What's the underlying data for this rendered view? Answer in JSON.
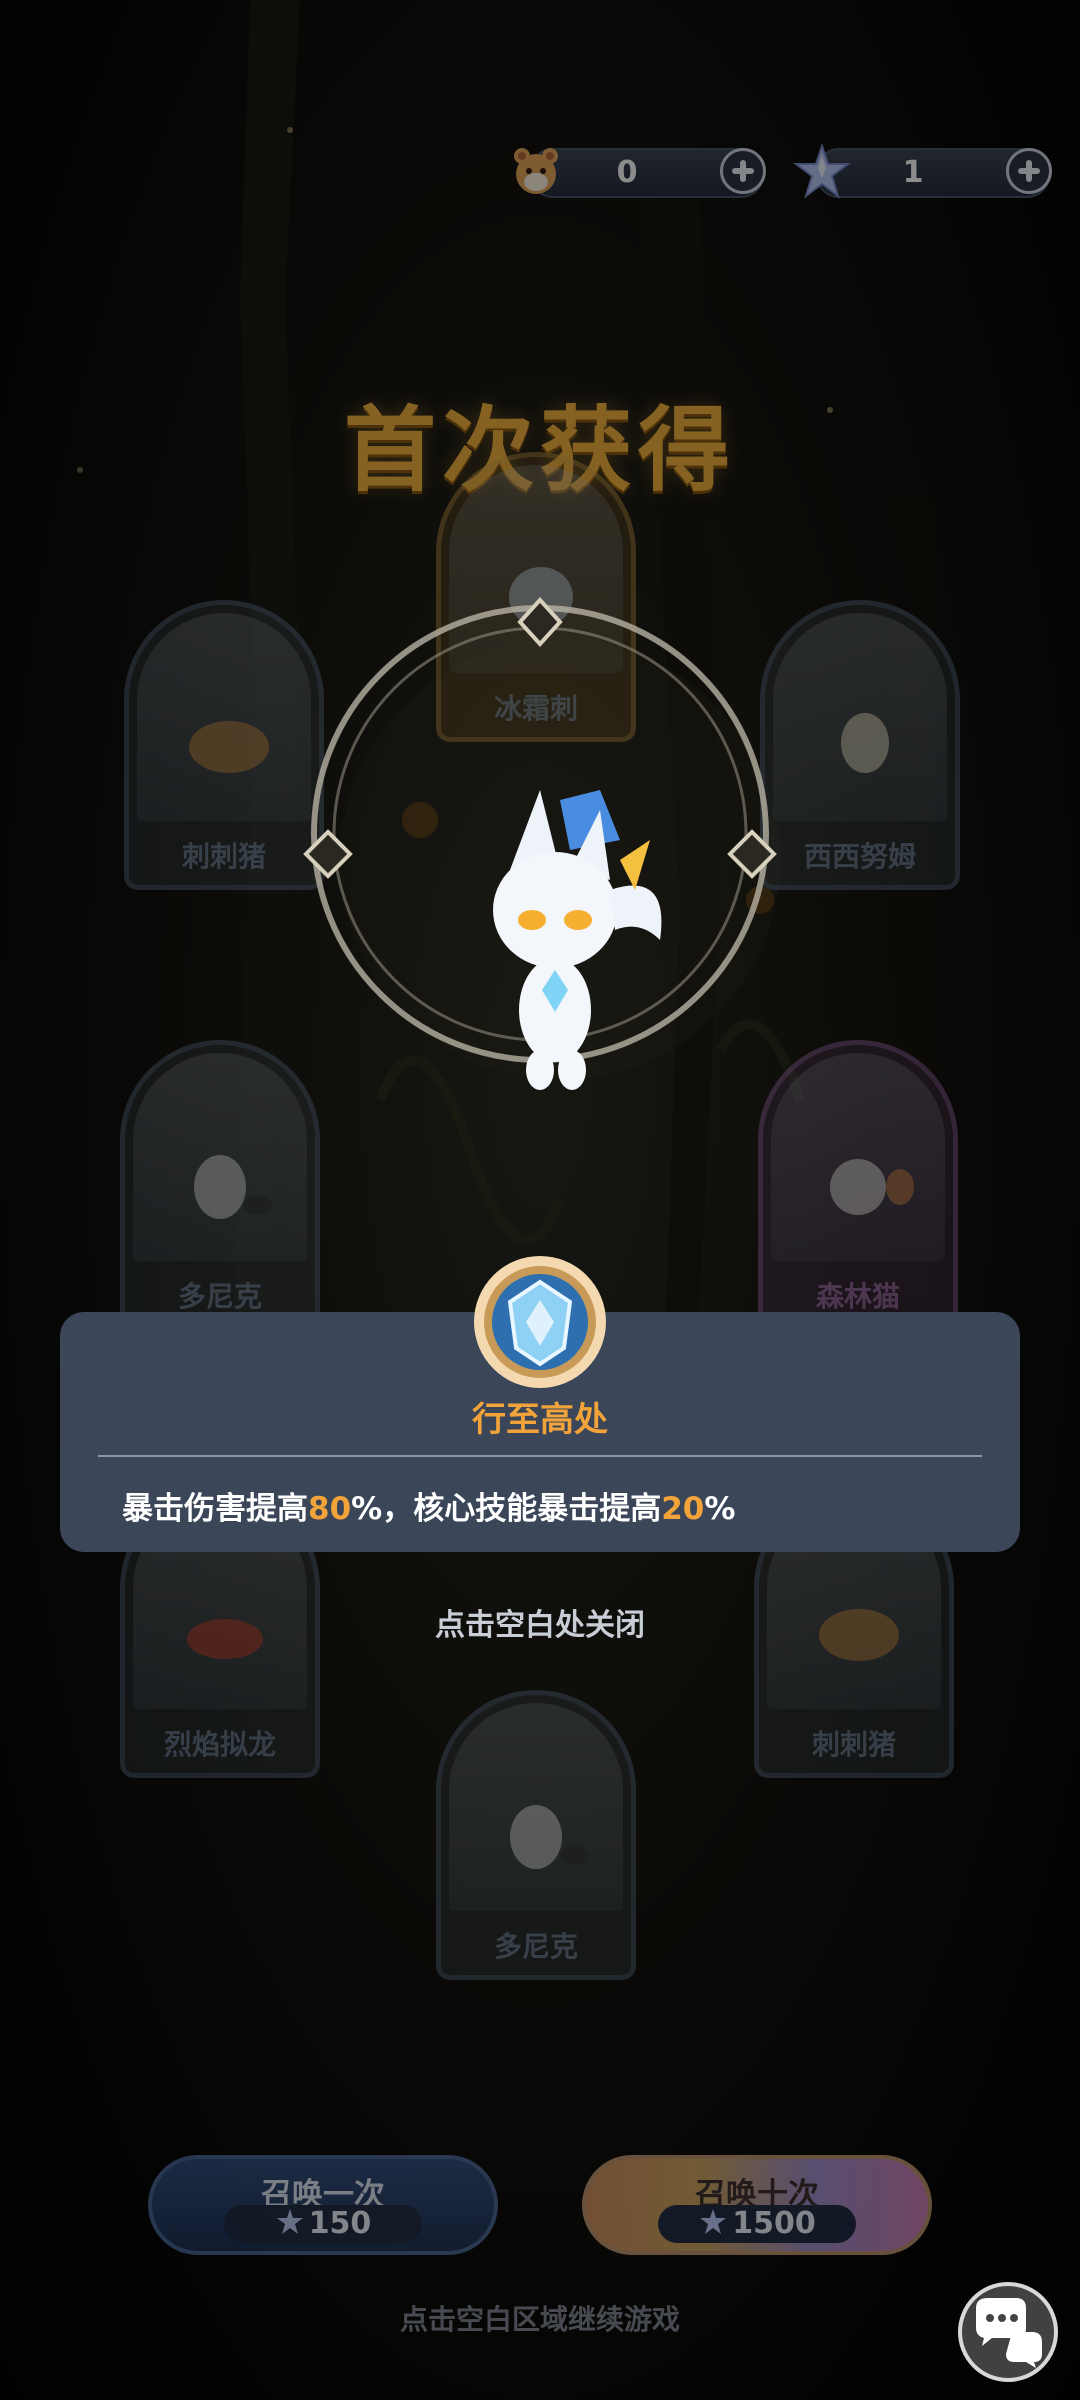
{
  "currency": {
    "pets": {
      "icon": "hamster-icon",
      "value": "0"
    },
    "stars": {
      "icon": "crystal-star-icon",
      "value": "1"
    }
  },
  "title": "首次获得",
  "cards": [
    {
      "name": "冰霜刺",
      "variant": "gold"
    },
    {
      "name": "刺刺猪",
      "variant": "normal"
    },
    {
      "name": "西西努姆",
      "variant": "normal"
    },
    {
      "name": "多尼克",
      "variant": "normal"
    },
    {
      "name": "森林猫",
      "variant": "purple"
    },
    {
      "name": "烈焰拟龙",
      "variant": "normal"
    },
    {
      "name": "刺刺猪",
      "variant": "normal"
    },
    {
      "name": "多尼克",
      "variant": "normal"
    }
  ],
  "skill": {
    "icon": "armor-crest-icon",
    "name": "行至高处",
    "desc_part1": "暴击伤害提高",
    "value1": "80",
    "desc_part2": "%，核心技能暴击提高",
    "value2": "20",
    "desc_part3": "%"
  },
  "close_hint": "点击空白处关闭",
  "summon": {
    "once": {
      "label": "召唤一次",
      "cost": "150"
    },
    "ten": {
      "label": "召唤十次",
      "cost": "1500"
    }
  },
  "continue_hint": "点击空白区域继续游戏",
  "chat_icon": "chat-bubbles-icon",
  "colors": {
    "title": "#f2b23e",
    "highlight": "#f2a43a",
    "panel": "#3b4658"
  }
}
